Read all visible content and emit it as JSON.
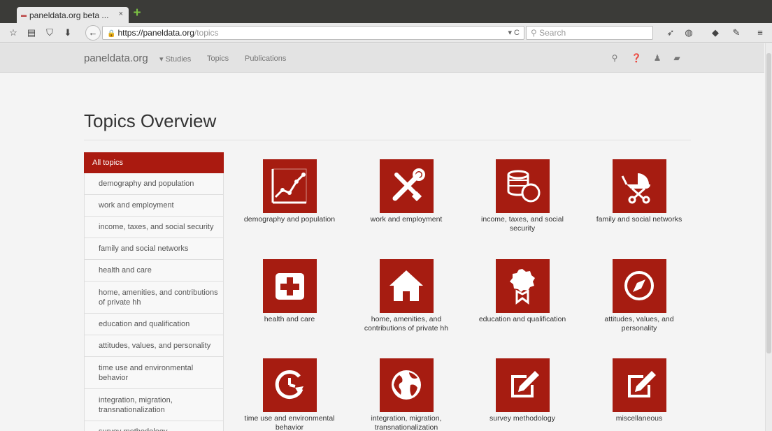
{
  "browser": {
    "tab_title": "paneldata.org beta ...",
    "tab_close": "×",
    "new_tab": "+",
    "url_host": "https://paneldata.org",
    "url_path": "/topics",
    "url_extra": "▾ C",
    "search_placeholder": "Search"
  },
  "site": {
    "brand": "paneldata.org",
    "nav": {
      "studies": "▾ Studies",
      "topics": "Topics",
      "publications": "Publications"
    }
  },
  "page": {
    "title": "Topics Overview"
  },
  "sidebar": {
    "items": [
      "All topics",
      "demography and population",
      "work and employment",
      "income, taxes, and social security",
      "family and social networks",
      "health and care",
      "home, amenities, and contributions of private hh",
      "education and qualification",
      "attitudes, values, and personality",
      "time use and environmental behavior",
      "integration, migration, transnationalization",
      "survey methodology"
    ]
  },
  "topics": [
    {
      "label": "demography and population",
      "icon": "line-chart-icon"
    },
    {
      "label": "work and employment",
      "icon": "tools-icon"
    },
    {
      "label": "income, taxes, and social security",
      "icon": "coins-icon"
    },
    {
      "label": "family and social networks",
      "icon": "stroller-icon"
    },
    {
      "label": "health and care",
      "icon": "medical-cross-icon"
    },
    {
      "label": "home, amenities, and contributions of private hh",
      "icon": "house-icon"
    },
    {
      "label": "education and qualification",
      "icon": "award-ribbon-icon"
    },
    {
      "label": "attitudes, values, and personality",
      "icon": "compass-icon"
    },
    {
      "label": "time use and environmental behavior",
      "icon": "clock-arrow-icon"
    },
    {
      "label": "integration, migration, transnationalization",
      "icon": "globe-icon"
    },
    {
      "label": "survey methodology",
      "icon": "edit-icon"
    },
    {
      "label": "miscellaneous",
      "icon": "edit-icon"
    }
  ],
  "colors": {
    "accent": "#a61c11",
    "sidebar_active": "#aa1a10"
  }
}
